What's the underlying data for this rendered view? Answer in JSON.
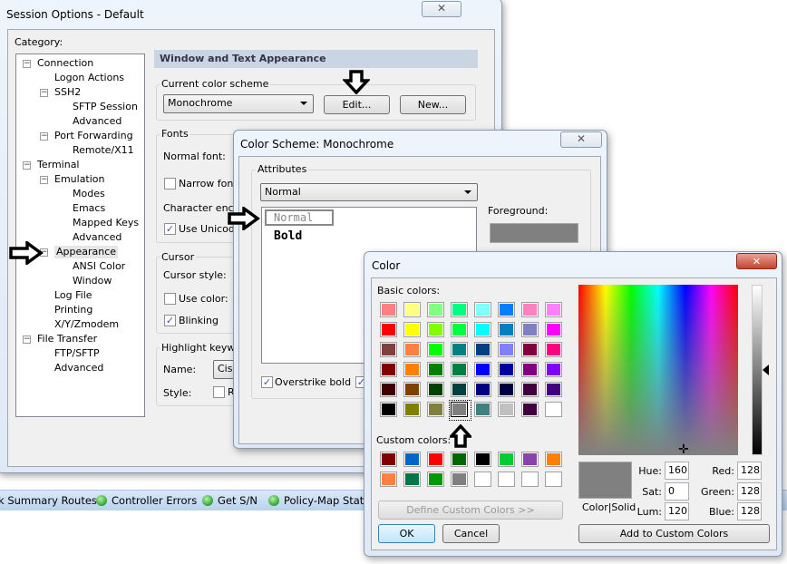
{
  "session": {
    "title": "Session Options - Default",
    "category_label": "Category:",
    "tree": [
      {
        "label": "Connection",
        "level": 0,
        "exp": true
      },
      {
        "label": "Logon Actions",
        "level": 1
      },
      {
        "label": "SSH2",
        "level": 1,
        "exp": true
      },
      {
        "label": "SFTP Session",
        "level": 2
      },
      {
        "label": "Advanced",
        "level": 2
      },
      {
        "label": "Port Forwarding",
        "level": 1,
        "exp": true
      },
      {
        "label": "Remote/X11",
        "level": 2
      },
      {
        "label": "Terminal",
        "level": 0,
        "exp": true
      },
      {
        "label": "Emulation",
        "level": 1,
        "exp": true
      },
      {
        "label": "Modes",
        "level": 2
      },
      {
        "label": "Emacs",
        "level": 2
      },
      {
        "label": "Mapped Keys",
        "level": 2
      },
      {
        "label": "Advanced",
        "level": 2
      },
      {
        "label": "Appearance",
        "level": 1,
        "exp": true,
        "selected": true
      },
      {
        "label": "ANSI Color",
        "level": 2
      },
      {
        "label": "Window",
        "level": 2
      },
      {
        "label": "Log File",
        "level": 1
      },
      {
        "label": "Printing",
        "level": 1
      },
      {
        "label": "X/Y/Zmodem",
        "level": 1
      },
      {
        "label": "File Transfer",
        "level": 0,
        "exp": true
      },
      {
        "label": "FTP/SFTP",
        "level": 1
      },
      {
        "label": "Advanced",
        "level": 1
      }
    ],
    "section_header": "Window and Text Appearance",
    "scheme_group": "Current color scheme",
    "scheme_value": "Monochrome",
    "edit_label": "Edit...",
    "new_label": "New...",
    "fonts_group": "Fonts",
    "normal_font": "Normal font:",
    "narrow_font": "Narrow font",
    "char_enc": "Character enco",
    "use_unicode": "Use Unicode",
    "cursor_group": "Cursor",
    "cursor_style": "Cursor style:",
    "use_color": "Use color:",
    "blinking": "Blinking",
    "highlight_group": "Highlight keywo",
    "name_label": "Name:",
    "name_value": "Cisc",
    "style_label": "Style:",
    "style_r": "R"
  },
  "status_bar": {
    "items": [
      "k Summary Routes",
      "Controller Errors",
      "Get S/N",
      "Policy-Map Stat"
    ],
    "led_color": "#3cb043"
  },
  "scheme_dialog": {
    "title": "Color Scheme: Monochrome",
    "attributes_group": "Attributes",
    "attribute_value": "Normal",
    "list": [
      "Normal",
      "Bold"
    ],
    "foreground_label": "Foreground:",
    "foreground_color": "#808080",
    "overstrike_bold": "Overstrike bold"
  },
  "color_dialog": {
    "title": "Color",
    "basic_label": "Basic colors:",
    "custom_label": "Custom colors:",
    "basic": [
      "#FF8080",
      "#FFFF80",
      "#80FF80",
      "#00FF80",
      "#80FFFF",
      "#0080FF",
      "#FF80C0",
      "#FF80FF",
      "#FF0000",
      "#FFFF00",
      "#80FF00",
      "#00FF40",
      "#00FFFF",
      "#0080C0",
      "#8080C0",
      "#FF00FF",
      "#804040",
      "#FF8040",
      "#00FF00",
      "#008080",
      "#004080",
      "#8080FF",
      "#800040",
      "#FF0080",
      "#800000",
      "#FF8000",
      "#008000",
      "#008040",
      "#0000FF",
      "#0000A0",
      "#800080",
      "#8000FF",
      "#400000",
      "#804000",
      "#004000",
      "#004040",
      "#000080",
      "#000040",
      "#400040",
      "#400080",
      "#000000",
      "#808000",
      "#808040",
      "#808080",
      "#408080",
      "#C0C0C0",
      "#400040",
      "#FFFFFF"
    ],
    "selected_basic": "#808080",
    "custom": [
      "#800000",
      "#0066CC",
      "#FF0000",
      "#006600",
      "#000000",
      "#00CC33",
      "#8844AA",
      "#FF8000",
      "#FF8040",
      "#007744",
      "#009900",
      "#808080",
      "#FFFFFF",
      "#FFFFFF",
      "#FFFFFF",
      "#FFFFFF"
    ],
    "define_custom": "Define Custom Colors >>",
    "ok": "OK",
    "cancel": "Cancel",
    "color_solid": "Color|Solid",
    "hue_label": "Hue:",
    "hue": "160",
    "sat_label": "Sat:",
    "sat": "0",
    "lum_label": "Lum:",
    "lum": "120",
    "red_label": "Red:",
    "red": "128",
    "green_label": "Green:",
    "green": "128",
    "blue_label": "Blue:",
    "blue": "128",
    "add_custom": "Add to Custom Colors",
    "current_color": "#808080"
  }
}
